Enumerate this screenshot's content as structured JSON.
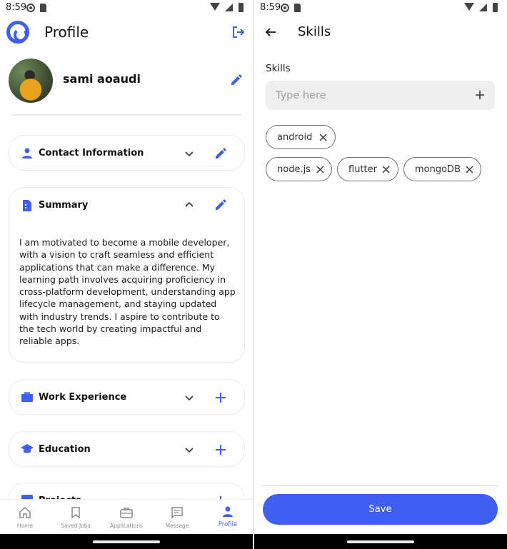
{
  "colors": {
    "accent": "#3f5ef2",
    "chip_border": "#6d6d6d",
    "input_bg": "#efefef"
  },
  "left_screen": {
    "status_time": "8:59",
    "title": "Profile",
    "user_name": "sami aoaudi",
    "sections": [
      {
        "title": "Contact Information",
        "icon": "person-icon",
        "action": "edit"
      },
      {
        "title": "Summary",
        "icon": "summary-doc-icon",
        "action": "edit",
        "text": "I am motivated to become a mobile developer, with a vision to craft seamless and efficient applications that can make a difference. My learning path involves acquiring proficiency in cross-platform development, understanding app lifecycle management, and staying updated with industry trends. I aspire to contribute to the tech world by creating impactful and reliable apps."
      },
      {
        "title": "Work Experience",
        "icon": "briefcase-icon",
        "action": "add"
      },
      {
        "title": "Education",
        "icon": "graduation-cap-icon",
        "action": "add"
      },
      {
        "title": "Projects",
        "icon": "bar-chart-icon",
        "action": "add"
      }
    ],
    "bottom_nav": [
      {
        "label": "Home",
        "icon": "home-icon"
      },
      {
        "label": "Saved Jobs",
        "icon": "bookmark-icon"
      },
      {
        "label": "Applications",
        "icon": "briefcase-icon"
      },
      {
        "label": "Message",
        "icon": "message-icon"
      },
      {
        "label": "Profile",
        "icon": "person-icon",
        "active": true
      }
    ]
  },
  "right_screen": {
    "status_time": "8:59",
    "title": "Skills",
    "skills_label": "Skills",
    "input_placeholder": "Type here",
    "skills": [
      "android",
      "node.js",
      "flutter",
      "mongoDB"
    ],
    "save_label": "Save"
  }
}
